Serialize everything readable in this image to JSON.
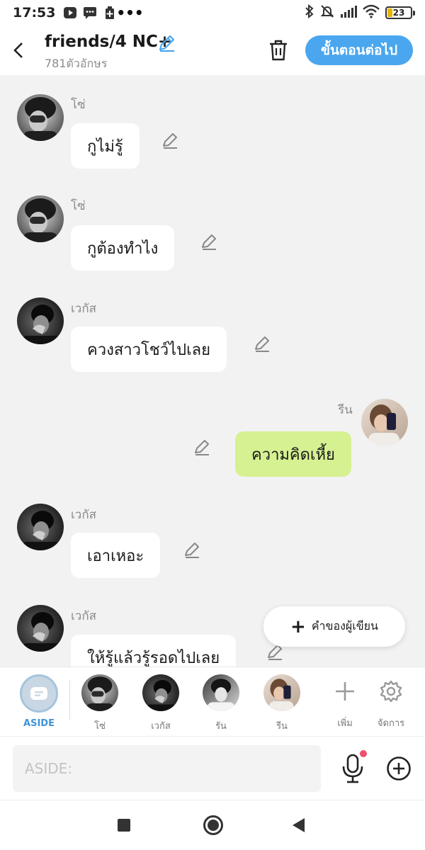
{
  "status_bar": {
    "time": "17:53",
    "battery": "23"
  },
  "header": {
    "title": "friends/4 NC+",
    "subtitle": "781ตัวอักษร",
    "next_label": "ขั้นตอนต่อไป"
  },
  "messages": [
    {
      "sender": "โซ่",
      "text": "กูไม่รู้",
      "side": "left"
    },
    {
      "sender": "โซ่",
      "text": "กูต้องทำไง",
      "side": "left"
    },
    {
      "sender": "เวกัส",
      "text": "ควงสาวโชว์ไปเลย",
      "side": "left"
    },
    {
      "sender": "รีน",
      "text": "ความคิดเหี้ย",
      "side": "right"
    },
    {
      "sender": "เวกัส",
      "text": "เอาเหอะ",
      "side": "left"
    },
    {
      "sender": "เวกัส",
      "text": "ให้รู้แล้วรู้รอดไปเลย",
      "side": "left"
    }
  ],
  "author_note": {
    "label": "คำของผู้เขียน"
  },
  "character_bar": {
    "aside_label": "ASIDE",
    "characters": [
      "โซ่",
      "เวกัส",
      "รัน",
      "รีน"
    ],
    "add_label": "เพิ่ม",
    "manage_label": "จัดการ"
  },
  "input": {
    "placeholder": "ASIDE:",
    "value": ""
  },
  "colors": {
    "accent": "#4aa6ee",
    "my_bubble": "#d6f191",
    "other_bubble": "#ffffff",
    "background": "#f2f2f2"
  }
}
